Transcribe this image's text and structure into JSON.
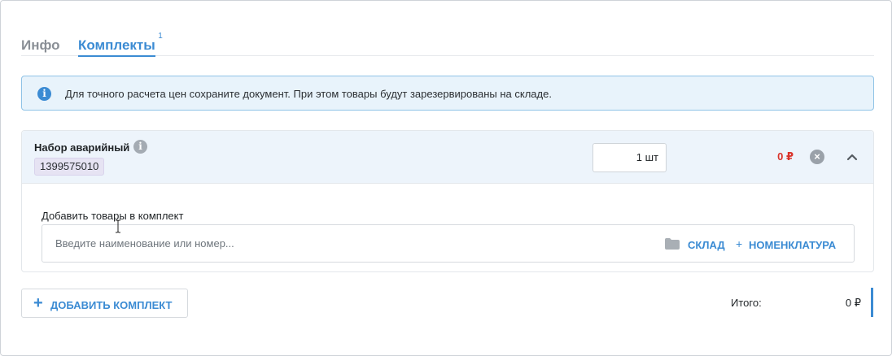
{
  "tabs": [
    {
      "label": "Инфо"
    },
    {
      "label": "Комплекты",
      "badge": "1"
    }
  ],
  "banner": {
    "text": "Для точного расчета цен сохраните документ. При этом товары будут зарезервированы на складе."
  },
  "kit": {
    "name": "Набор аварийный",
    "code": "1399575010",
    "quantity": "1 шт",
    "price": "0 ₽",
    "add_label": "Добавить товары в комплект",
    "search_placeholder": "Введите наименование или номер...",
    "warehouse_link": "СКЛАД",
    "plus": "+",
    "nomenclature_link": "НОМЕНКЛАТУРА"
  },
  "add_kit_button": {
    "plus": "+",
    "label": "ДОБАВИТЬ КОМПЛЕКТ"
  },
  "total": {
    "label": "Итого:",
    "value": "0 ₽"
  },
  "colors": {
    "accent": "#3b8bd3",
    "price_red": "#d9342b",
    "banner_bg": "#e8f3fb"
  }
}
